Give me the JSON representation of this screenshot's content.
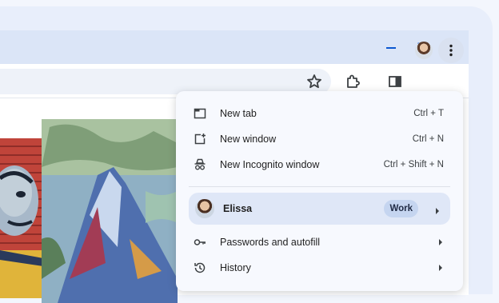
{
  "window": {
    "controls": [
      "minimize-icon",
      "maximize-icon",
      "close-icon"
    ]
  },
  "toolbar": {
    "icons": [
      "bookmark-star-icon",
      "extensions-icon",
      "side-panel-icon",
      "profile-avatar",
      "more-menu-icon"
    ]
  },
  "menu": {
    "items_top": [
      {
        "label": "New tab",
        "shortcut": "Ctrl + T",
        "icon": "new-tab-icon"
      },
      {
        "label": "New window",
        "shortcut": "Ctrl + N",
        "icon": "new-window-icon"
      },
      {
        "label": "New Incognito window",
        "shortcut": "Ctrl + Shift + N",
        "icon": "incognito-icon"
      }
    ],
    "profile": {
      "name": "Elissa",
      "badge": "Work"
    },
    "items_bottom": [
      {
        "label": "Passwords and autofill",
        "icon": "key-icon"
      },
      {
        "label": "History",
        "icon": "history-icon"
      }
    ]
  },
  "colors": {
    "accent": "#0b57d0",
    "titlebar": "#dbe5f7",
    "menu_background": "#f7f9fe",
    "profile_highlight": "#dfe7f7"
  }
}
